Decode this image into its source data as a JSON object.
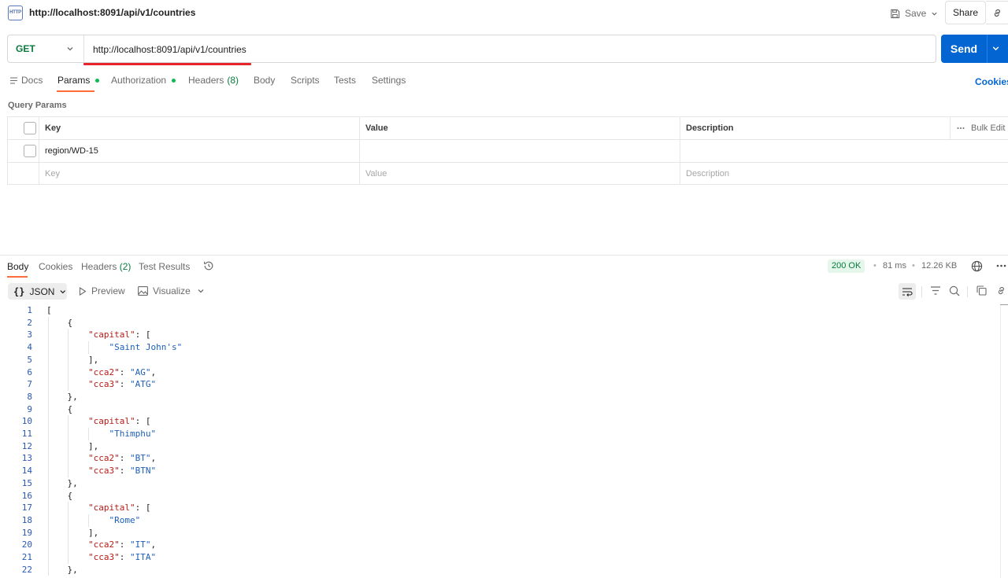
{
  "request": {
    "title": "http://localhost:8091/api/v1/countries",
    "icon": "http-icon",
    "icon_text": "HTTP",
    "save_label": "Save",
    "share_label": "Share"
  },
  "urlbar": {
    "method": "GET",
    "url": "http://localhost:8091/api/v1/countries",
    "send_label": "Send"
  },
  "request_tabs": {
    "docs": "Docs",
    "params": "Params",
    "authorization": "Authorization",
    "headers": "Headers",
    "headers_count": "(8)",
    "body": "Body",
    "scripts": "Scripts",
    "tests": "Tests",
    "settings": "Settings",
    "cookies": "Cookies"
  },
  "params": {
    "section_title": "Query Params",
    "headers": {
      "key": "Key",
      "value": "Value",
      "description": "Description",
      "bulk_edit": "Bulk Edit"
    },
    "rows": [
      {
        "checked": false,
        "key": "region/WD-15",
        "value": "",
        "description": ""
      }
    ],
    "placeholders": {
      "key": "Key",
      "value": "Value",
      "description": "Description"
    }
  },
  "response": {
    "tabs": {
      "body": "Body",
      "cookies": "Cookies",
      "headers": "Headers",
      "headers_count": "(2)",
      "test_results": "Test Results"
    },
    "status": "200 OK",
    "time": "81 ms",
    "size": "12.26 KB",
    "status_color": "#0a7a3e"
  },
  "body_toolbar": {
    "format": "JSON",
    "preview": "Preview",
    "visualize": "Visualize"
  },
  "code_lines": [
    "[",
    "    {",
    "        \"capital\": [",
    "            \"Saint John's\"",
    "        ],",
    "        \"cca2\": \"AG\",",
    "        \"cca3\": \"ATG\"",
    "    },",
    "    {",
    "        \"capital\": [",
    "            \"Thimphu\"",
    "        ],",
    "        \"cca2\": \"BT\",",
    "        \"cca3\": \"BTN\"",
    "    },",
    "    {",
    "        \"capital\": [",
    "            \"Rome\"",
    "        ],",
    "        \"cca2\": \"IT\",",
    "        \"cca3\": \"ITA\"",
    "    },"
  ],
  "colors": {
    "accent": "#ff6c37",
    "send": "#0265d2",
    "method": "#0a7a3e",
    "json_key": "#b81b17",
    "json_string": "#1d5fb8"
  }
}
